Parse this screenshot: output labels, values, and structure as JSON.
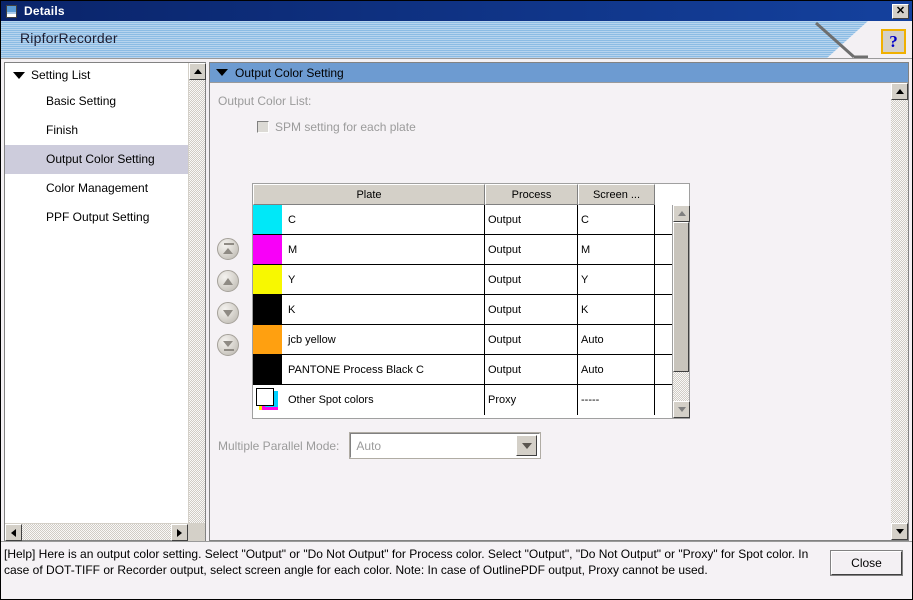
{
  "window": {
    "title": "Details",
    "icon": "document-icon",
    "close_label": "✕"
  },
  "banner": {
    "title": "RipforRecorder",
    "help_label": "?"
  },
  "sidebar": {
    "root_label": "Setting List",
    "items": [
      {
        "label": "Basic Setting",
        "selected": false
      },
      {
        "label": "Finish",
        "selected": false
      },
      {
        "label": "Output Color Setting",
        "selected": true
      },
      {
        "label": "Color Management",
        "selected": false
      },
      {
        "label": "PPF Output Setting",
        "selected": false
      }
    ]
  },
  "section": {
    "title": "Output Color Setting"
  },
  "content": {
    "output_color_list_label": "Output Color List:",
    "spm_checkbox": {
      "label": "SPM setting for each plate",
      "checked": false,
      "enabled": false
    },
    "order_buttons": [
      {
        "name": "move-to-top",
        "tooltip": "Move to top"
      },
      {
        "name": "move-up",
        "tooltip": "Move up"
      },
      {
        "name": "move-down",
        "tooltip": "Move down"
      },
      {
        "name": "move-to-bottom",
        "tooltip": "Move to bottom"
      }
    ],
    "table": {
      "columns": [
        "Plate",
        "Process",
        "Screen ..."
      ],
      "rows": [
        {
          "swatch": "#00e8f8",
          "swatch_type": "solid",
          "plate": "C",
          "process": "Output",
          "screen": "C"
        },
        {
          "swatch": "#f800f8",
          "swatch_type": "solid",
          "plate": "M",
          "process": "Output",
          "screen": "M"
        },
        {
          "swatch": "#f8f800",
          "swatch_type": "solid",
          "plate": "Y",
          "process": "Output",
          "screen": "Y"
        },
        {
          "swatch": "#000000",
          "swatch_type": "solid",
          "plate": "K",
          "process": "Output",
          "screen": "K"
        },
        {
          "swatch": "#ffa010",
          "swatch_type": "solid",
          "plate": "jcb yellow",
          "process": "Output",
          "screen": "Auto"
        },
        {
          "swatch": "#000000",
          "swatch_type": "solid",
          "plate": "PANTONE Process Black C",
          "process": "Output",
          "screen": "Auto"
        },
        {
          "swatch": "#ffffff",
          "swatch_type": "spot-stack",
          "plate": "Other Spot colors",
          "process": "Proxy",
          "screen": "-----"
        }
      ]
    },
    "parallel_mode": {
      "label": "Multiple Parallel Mode:",
      "value": "Auto",
      "enabled": false
    }
  },
  "footer": {
    "help_text": "[Help] Here is an output color setting. Select \"Output\" or \"Do Not Output\" for Process color. Select \"Output\", \"Do Not Output\" or \"Proxy\" for Spot color. In case of DOT-TIFF or Recorder output, select screen angle for each color.  Note: In case of OutlinePDF output, Proxy cannot be used.",
    "close_label": "Close"
  },
  "colors": {
    "titlebar": "#0a246a",
    "banner_stripe": "#8cbce4",
    "section_header": "#6d9bd1",
    "selection": "#cdccdc",
    "face": "#d4d0c8",
    "panel": "#f5f2f5"
  }
}
